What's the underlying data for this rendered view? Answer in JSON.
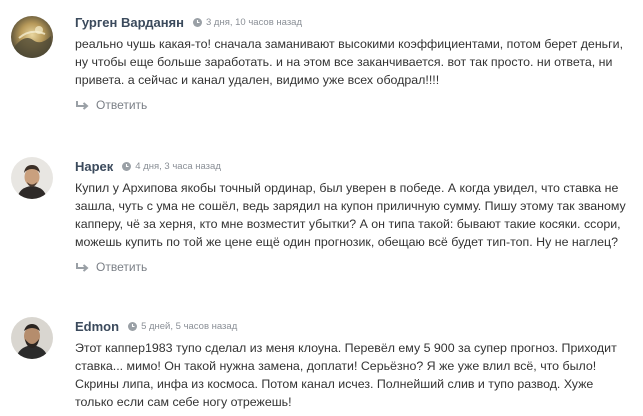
{
  "comments": [
    {
      "author": "Гурген Варданян",
      "date": "3 дня, 10 часов назад",
      "text": "реально чушь какая-то! сначала заманивают высокими коэффициентами, потом берет деньги, ну чтобы еще больше заработать. и на этом все заканчивается. вот так просто. ни ответа, ни привета. а сейчас и канал удален, видимо уже всех ободрал!!!!",
      "reply_label": "Ответить"
    },
    {
      "author": "Нарек",
      "date": "4 дня, 3 часа назад",
      "text": "Купил у Архипова якобы точный ординар, был уверен в победе. А когда увидел, что ставка не зашла, чуть с ума не сошёл, ведь зарядил на купон приличную сумму. Пишу этому так званому капперу, чё за херня, кто мне возместит убытки? А он типа такой: бывают такие косяки. ссори, можешь купить по той же цене ещё один прогнозик, обещаю всё будет тип-топ. Ну не наглец?",
      "reply_label": "Ответить"
    },
    {
      "author": "Edmon",
      "date": "5 дней, 5 часов назад",
      "text": "Этот каппер1983 тупо сделал из меня клоуна. Перевёл ему 5 900 за супер прогноз. Приходит ставка... мимо! Он такой нужна замена, доплати! Серьёзно? Я же уже влил всё, что было! Скрины липа, инфа из космоса. Потом канал исчез. Полнейший слив и тупо развод. Хуже только если сам себе ногу отрежешь!"
    }
  ],
  "icons": {
    "clock": "clock-icon",
    "reply": "reply-arrow-icon"
  },
  "colors": {
    "author": "#3b4a5c",
    "date": "#8a8f96",
    "text": "#333333",
    "reply": "#7a7f86"
  }
}
